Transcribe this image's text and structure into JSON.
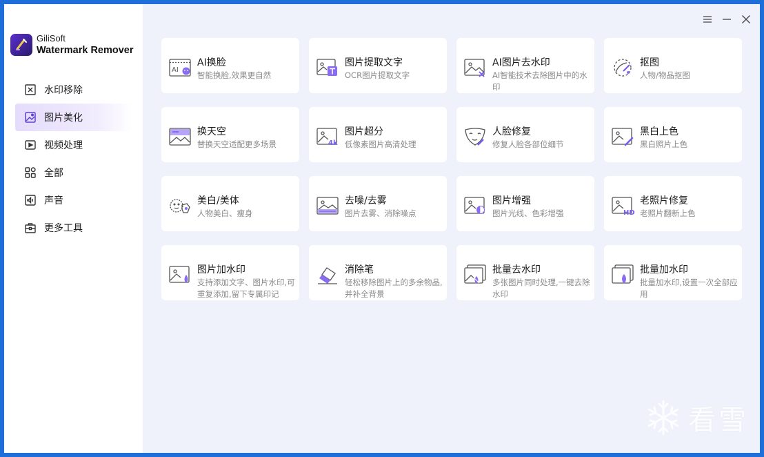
{
  "app": {
    "brand_top": "GiliSoft",
    "brand_name": "Watermark Remover",
    "accent": "#7b5cf0"
  },
  "sidebar": {
    "items": [
      {
        "label": "水印移除",
        "icon": "watermark-remove-icon"
      },
      {
        "label": "图片美化",
        "icon": "image-beautify-icon",
        "active": true
      },
      {
        "label": "视频处理",
        "icon": "video-icon"
      },
      {
        "label": "全部",
        "icon": "grid-icon"
      },
      {
        "label": "声音",
        "icon": "audio-icon"
      },
      {
        "label": "更多工具",
        "icon": "toolbox-icon"
      }
    ]
  },
  "window_controls": {
    "menu": "menu-icon",
    "minimize": "minimize-icon",
    "close": "close-icon"
  },
  "tools": [
    {
      "title": "AI换脸",
      "desc": "智能换脸,效果更自然",
      "icon": "ai-face-swap-icon"
    },
    {
      "title": "图片提取文字",
      "desc": "OCR图片提取文字",
      "icon": "ocr-icon"
    },
    {
      "title": "AI图片去水印",
      "desc": "AI智能技术去除图片中的水印",
      "icon": "ai-remove-watermark-icon"
    },
    {
      "title": "抠图",
      "desc": "人物/物品抠图",
      "icon": "cutout-icon"
    },
    {
      "title": "换天空",
      "desc": "替换天空适配更多场景",
      "icon": "sky-replace-icon"
    },
    {
      "title": "图片超分",
      "desc": "低像素图片高清处理",
      "icon": "super-resolution-icon"
    },
    {
      "title": "人脸修复",
      "desc": "修复人脸各部位细节",
      "icon": "face-repair-icon"
    },
    {
      "title": "黑白上色",
      "desc": "黑白照片上色",
      "icon": "colorize-icon"
    },
    {
      "title": "美白/美体",
      "desc": "人物美白、瘦身",
      "icon": "beautify-body-icon"
    },
    {
      "title": "去噪/去雾",
      "desc": "图片去雾、消除噪点",
      "icon": "denoise-icon"
    },
    {
      "title": "图片增强",
      "desc": "图片光线、色彩增强",
      "icon": "enhance-icon"
    },
    {
      "title": "老照片修复",
      "desc": "老照片翻新上色",
      "icon": "old-photo-repair-icon"
    },
    {
      "title": "图片加水印",
      "desc": "支持添加文字、图片水印,可重复添加,留下专属印记",
      "icon": "add-watermark-icon"
    },
    {
      "title": "消除笔",
      "desc": "轻松移除图片上的多余物品,并补全背景",
      "icon": "eraser-icon"
    },
    {
      "title": "批量去水印",
      "desc": "多张图片同时处理,一键去除水印",
      "icon": "batch-remove-watermark-icon"
    },
    {
      "title": "批量加水印",
      "desc": "批量加水印,设置一次全部应用",
      "icon": "batch-add-watermark-icon"
    }
  ],
  "watermark": {
    "text": "看雪",
    "icon": "snowflake-icon"
  }
}
